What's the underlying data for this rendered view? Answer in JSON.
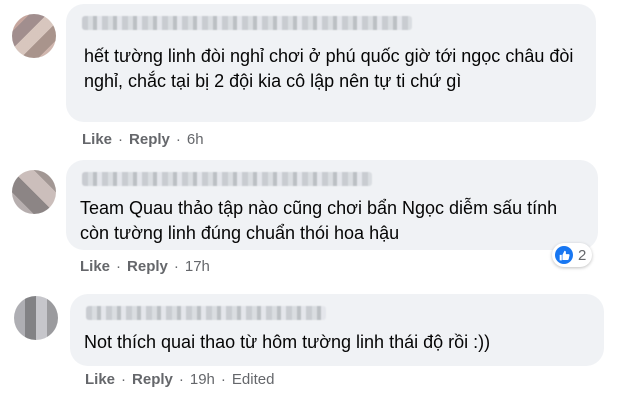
{
  "comments": [
    {
      "text": "hết tường linh đòi nghỉ chơi ở phú quốc giờ tới ngọc châu đòi nghỉ, chắc tại bị 2 đội kia cô lập nên tự ti chứ gì",
      "like_label": "Like",
      "reply_label": "Reply",
      "time": "6h"
    },
    {
      "text": "Team Quau thảo tập nào cũng chơi bẩn Ngọc diễm sấu tính còn tường linh đúng chuẩn thói hoa hậu",
      "like_label": "Like",
      "reply_label": "Reply",
      "time": "17h",
      "reaction_icon": "like-icon",
      "reaction_count": "2"
    },
    {
      "text": "Not thích quai thao từ hôm tường linh thái độ rồi :))",
      "like_label": "Like",
      "reply_label": "Reply",
      "time": "19h",
      "edited_label": "Edited"
    }
  ],
  "colors": {
    "bubble": "#f0f2f5",
    "meta_text": "#65676b",
    "like_blue": "#1877f2"
  }
}
